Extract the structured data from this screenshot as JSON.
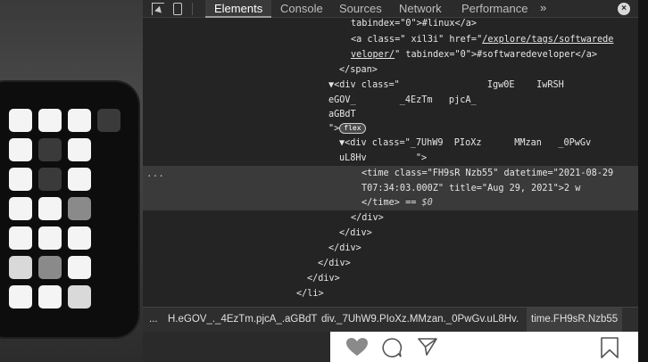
{
  "devtools": {
    "tabs": [
      "Elements",
      "Console",
      "Sources",
      "Network",
      "Performance"
    ],
    "more_tabs": "»",
    "close": "×",
    "dom_lines": [
      "tabindex=\"0\">#linux</a>",
      "<a class=\" xil3i\" href=\"",
      "/explore/tags/softwarede",
      "veloper/",
      "\" tabindex=\"0\">#softwaredeveloper</a>",
      "</span>",
      "▼<div class=\"                Igw0E    IwRSH",
      "eGOV_        _4EzTm   pjcA_",
      "aGBdT",
      "\">",
      "flex",
      "▼<div class=\"_7UhW9  PIoXz      MMzan   _0PwGv",
      "uL8Hv         \">",
      "<time class=\"FH9sR Nzb55\" datetime=\"2021-08-29",
      "T07:34:03.000Z\" title=\"Aug 29, 2021\">2 w",
      "</time> == ",
      "$0",
      "</div>",
      "</div>",
      "</div>",
      "</div>",
      "</div>",
      "</li>"
    ],
    "ellipsis": "...",
    "breadcrumbs": {
      "more": "...",
      "items": [
        "H.eGOV_._4EzTm.pjcA_.aGBdT",
        "div._7UhW9.PIoXz.MMzan._0PwGv.uL8Hv.",
        "time.FH9sR.Nzb55"
      ]
    }
  },
  "post_actions": {
    "icons": [
      "heart-icon",
      "comment-icon",
      "share-icon",
      "bookmark-icon"
    ]
  },
  "colors": {
    "devtools_bg": "#242424",
    "selected_row": "#3a3a3a",
    "action_bar": "#ffffff"
  }
}
